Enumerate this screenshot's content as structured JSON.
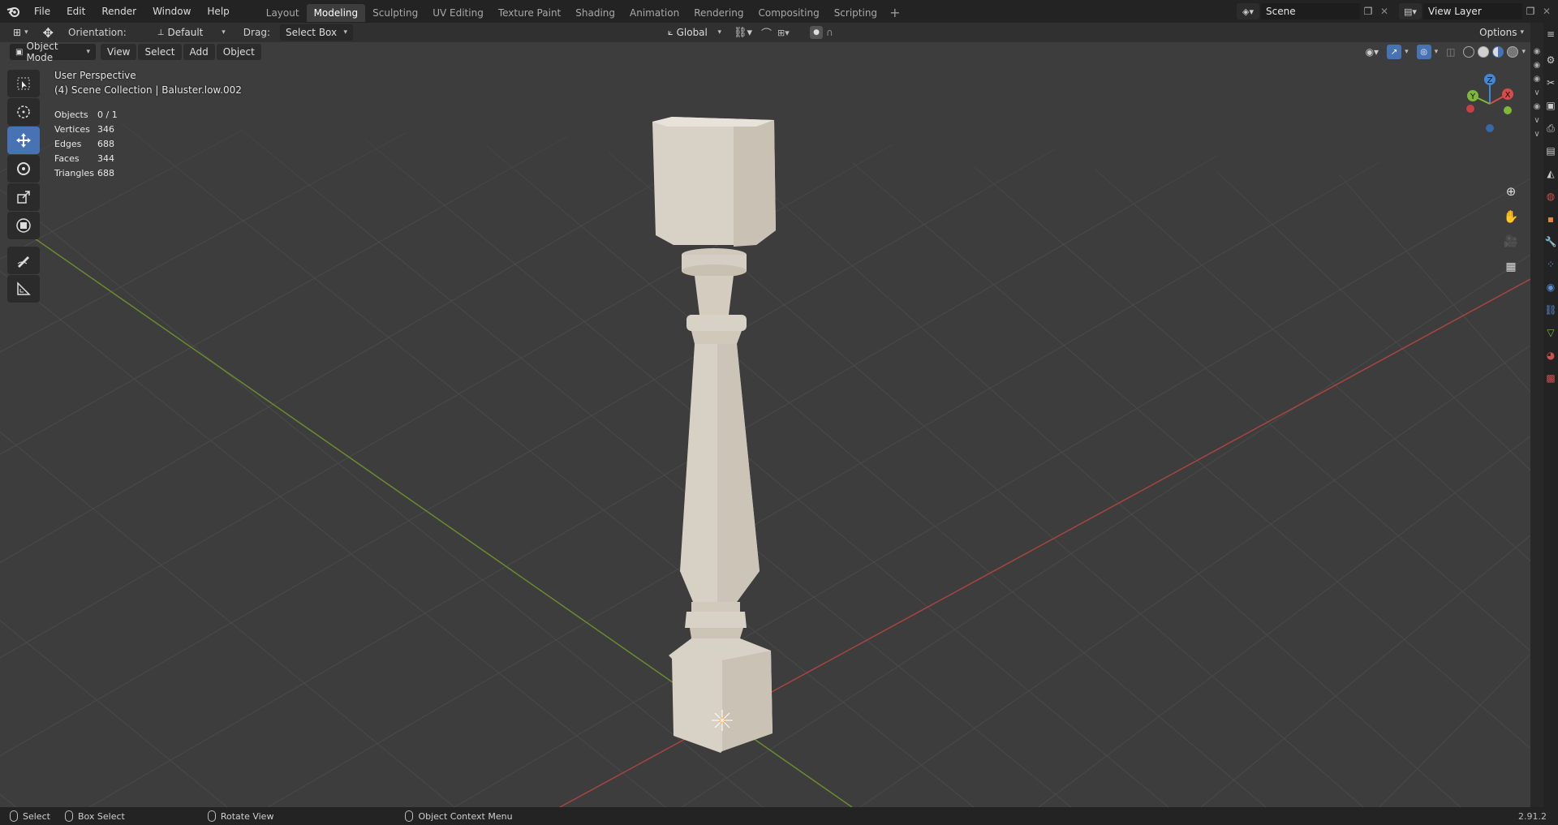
{
  "topbar": {
    "menu": [
      "File",
      "Edit",
      "Render",
      "Window",
      "Help"
    ],
    "workspaces": [
      "Layout",
      "Modeling",
      "Sculpting",
      "UV Editing",
      "Texture Paint",
      "Shading",
      "Animation",
      "Rendering",
      "Compositing",
      "Scripting"
    ],
    "active_workspace": "Modeling",
    "add_tab": "+",
    "scene": "Scene",
    "view_layer": "View Layer"
  },
  "tool_header": {
    "orientation_label": "Orientation:",
    "orientation_value": "Default",
    "drag_label": "Drag:",
    "drag_value": "Select Box",
    "transform_orientation": "Global",
    "options": "Options"
  },
  "viewport_header": {
    "mode": "Object Mode",
    "menus": [
      "View",
      "Select",
      "Add",
      "Object"
    ]
  },
  "viewport": {
    "perspective": "User Perspective",
    "collection": "(4) Scene Collection | Baluster.low.002",
    "stats": [
      {
        "key": "Objects",
        "value": "0 / 1"
      },
      {
        "key": "Vertices",
        "value": "346"
      },
      {
        "key": "Edges",
        "value": "688"
      },
      {
        "key": "Faces",
        "value": "344"
      },
      {
        "key": "Triangles",
        "value": "688"
      }
    ],
    "gizmo_axes": {
      "x": "X",
      "y": "Y",
      "z": "Z"
    },
    "colors": {
      "x_axis": "#d74b4b",
      "y_axis": "#7eb73a",
      "z_axis": "#3f88d8",
      "grid": "#4a4a4a",
      "object": "#d9d2c6"
    }
  },
  "statusbar": {
    "items": [
      "Select",
      "Box Select",
      "Rotate View",
      "Object Context Menu"
    ],
    "version": "2.91.2"
  }
}
